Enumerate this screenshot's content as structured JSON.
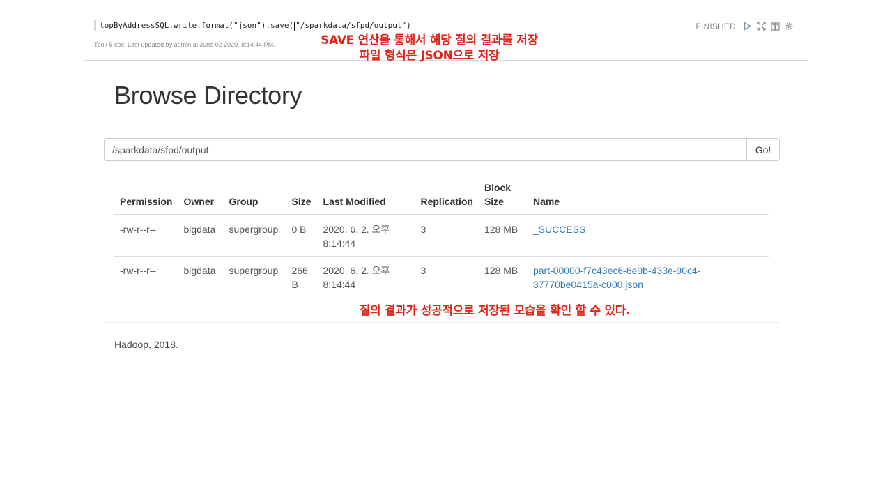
{
  "paragraph": {
    "code_before_cursor": "topByAddressSQL.write.format(\"json\").save(",
    "code_after_cursor": "\"/sparkdata/sfpd/output\")",
    "took": "Took 5 sec. Last updated by admin at June 02 2020, 8:14:44 PM.",
    "status": "FINISHED",
    "icons": [
      "run-icon",
      "expand-icon",
      "book-icon",
      "gear-icon"
    ]
  },
  "annotations": {
    "top_line1": "SAVE 연산을 통해서 해당 질의 결과를 저장",
    "top_line2": "파일 형식은 JSON으로 저장",
    "bottom": "질의 결과가 성공적으로 저장된 모습을 확인 할 수 있다.",
    "color": "#e2231a"
  },
  "browse": {
    "title": "Browse Directory",
    "path_value": "/sparkdata/sfpd/output",
    "go_label": "Go!",
    "columns": {
      "permission": "Permission",
      "owner": "Owner",
      "group": "Group",
      "size": "Size",
      "last_modified": "Last Modified",
      "replication": "Replication",
      "block_size_1": "Block",
      "block_size_2": "Size",
      "name": "Name"
    },
    "rows": [
      {
        "permission": "-rw-r--r--",
        "owner": "bigdata",
        "group": "supergroup",
        "size_1": "0 B",
        "size_2": "",
        "modified_1": "2020. 6. 2. 오후",
        "modified_2": "8:14:44",
        "replication": "3",
        "block_size": "128 MB",
        "name_1": "_SUCCESS",
        "name_2": ""
      },
      {
        "permission": "-rw-r--r--",
        "owner": "bigdata",
        "group": "supergroup",
        "size_1": "266",
        "size_2": "B",
        "modified_1": "2020. 6. 2. 오후",
        "modified_2": "8:14:44",
        "replication": "3",
        "block_size": "128 MB",
        "name_1": "part-00000-f7c43ec6-6e9b-433e-90c4-",
        "name_2": "37770be0415a-c000.json"
      }
    ],
    "footer": "Hadoop, 2018."
  },
  "colors": {
    "link": "#337ab7",
    "status_gray": "#8a8a8a"
  }
}
